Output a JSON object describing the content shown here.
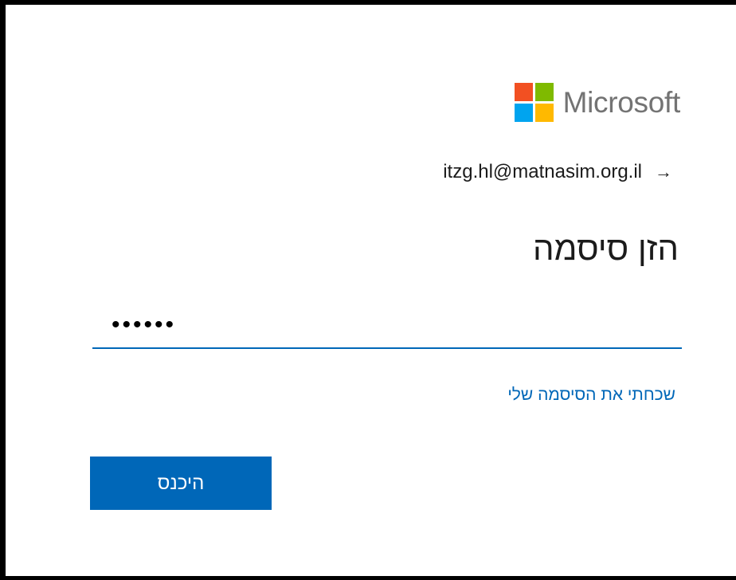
{
  "brand": {
    "name": "Microsoft",
    "logo_colors": [
      "#f25022",
      "#7fba00",
      "#00a4ef",
      "#ffb900"
    ]
  },
  "identity": {
    "email": "itzg.hl@matnasim.org.il",
    "arrow_icon": "arrow-right-icon",
    "arrow_glyph": "→"
  },
  "form": {
    "title": "הזן סיסמה",
    "password_value": "••••••",
    "forgot_link": "שכחתי את הסיסמה שלי",
    "submit_label": "היכנס"
  },
  "colors": {
    "accent": "#0067b8",
    "text": "#1b1b1b",
    "logo_text": "#737373"
  }
}
